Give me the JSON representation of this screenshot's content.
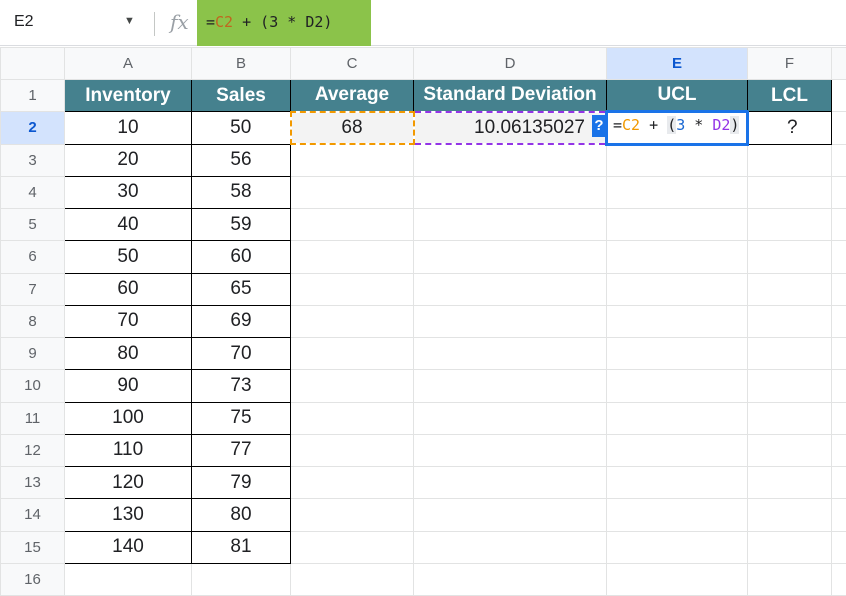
{
  "formula_bar": {
    "cell_ref": "E2",
    "formula_prefix": "=",
    "formula_ref1": "C2",
    "formula_rest": " + (3 * D2)"
  },
  "columns": [
    "A",
    "B",
    "C",
    "D",
    "E",
    "F"
  ],
  "selected_column": "E",
  "rows": [
    "1",
    "2",
    "3",
    "4",
    "5",
    "6",
    "7",
    "8",
    "9",
    "10",
    "11",
    "12",
    "13",
    "14",
    "15",
    "16"
  ],
  "headers": {
    "inventory": "Inventory",
    "sales": "Sales",
    "average": "Average",
    "std_dev": "Standard Deviation",
    "ucl": "UCL",
    "lcl": "LCL"
  },
  "data": [
    {
      "inventory": "10",
      "sales": "50"
    },
    {
      "inventory": "20",
      "sales": "56"
    },
    {
      "inventory": "30",
      "sales": "58"
    },
    {
      "inventory": "40",
      "sales": "59"
    },
    {
      "inventory": "50",
      "sales": "60"
    },
    {
      "inventory": "60",
      "sales": "65"
    },
    {
      "inventory": "70",
      "sales": "69"
    },
    {
      "inventory": "80",
      "sales": "70"
    },
    {
      "inventory": "90",
      "sales": "73"
    },
    {
      "inventory": "100",
      "sales": "75"
    },
    {
      "inventory": "110",
      "sales": "77"
    },
    {
      "inventory": "120",
      "sales": "79"
    },
    {
      "inventory": "130",
      "sales": "80"
    },
    {
      "inventory": "140",
      "sales": "81"
    }
  ],
  "average_value": "68",
  "std_dev_value": "10.06135027",
  "ucl_editor": {
    "eq": "=",
    "c2": "C2",
    "plus": " + ",
    "open": "(",
    "three": "3",
    "times": " * ",
    "d2": "D2",
    "close": ")"
  },
  "lcl_value": "?",
  "help_icon": "?",
  "colors": {
    "header_fill": "#45818e",
    "formula_bar_highlight": "#8bc34a",
    "selection_blue": "#1a73e8",
    "c2_ref": "#f29900",
    "d2_ref": "#9334e6"
  },
  "icons": {
    "fx": "fx-icon",
    "dropdown": "chevron-down-icon",
    "help": "help-icon"
  }
}
